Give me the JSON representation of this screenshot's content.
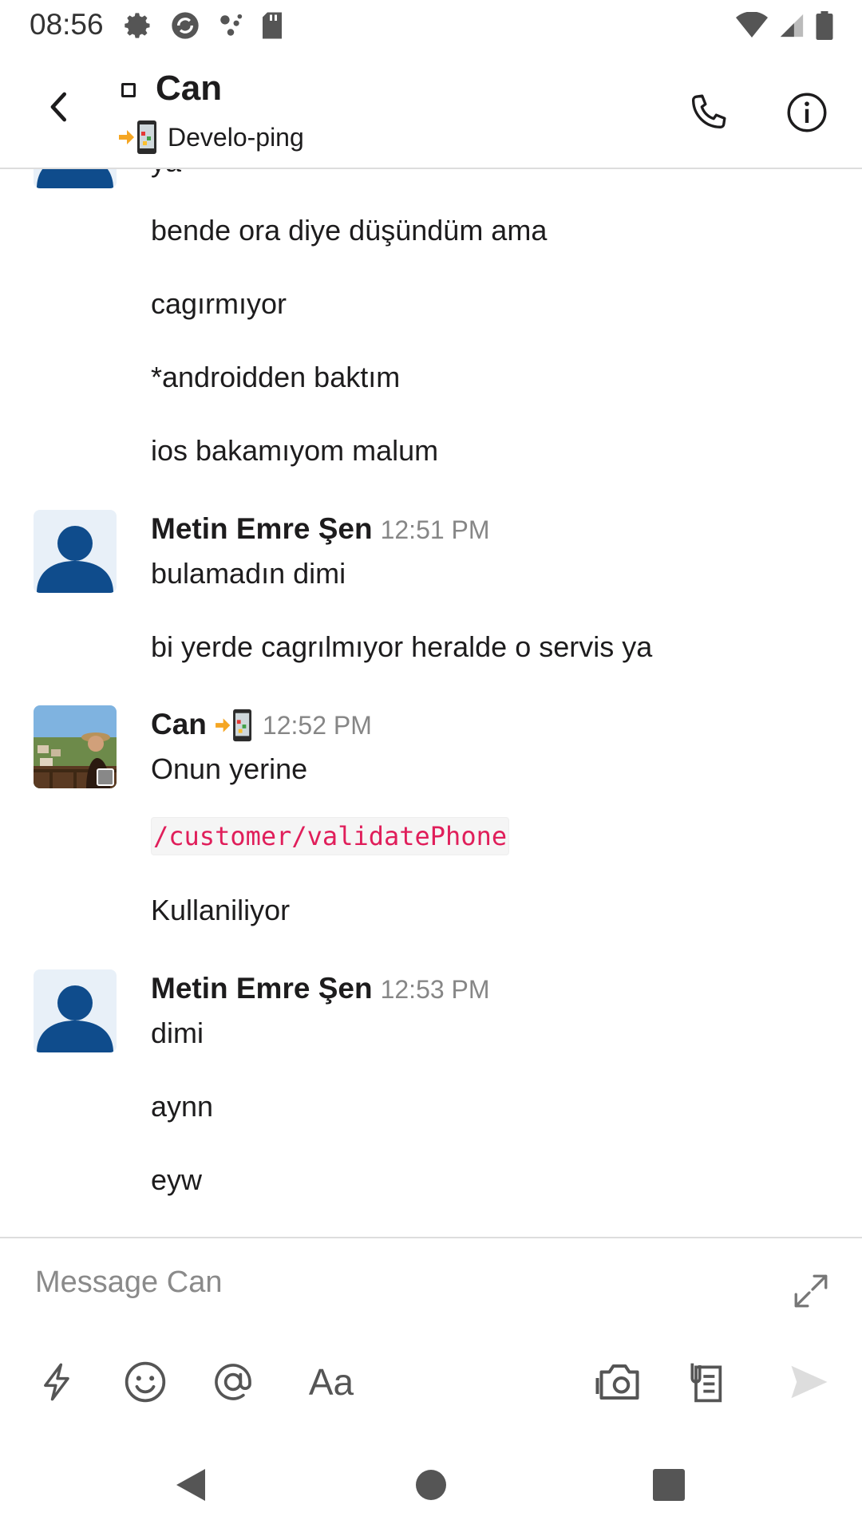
{
  "status_bar": {
    "time": "08:56",
    "left_icons": [
      "gear-icon",
      "sync-icon",
      "assistant-dots-icon",
      "sd-card-icon"
    ],
    "right_icons": [
      "wifi-icon",
      "signal-icon",
      "battery-icon"
    ]
  },
  "header": {
    "name": "Can",
    "status_text": "Develo-ping",
    "status_emoji": "arrow-phone-icon"
  },
  "messages": {
    "cut_off_text": "ya",
    "group0": {
      "lines": [
        "bende ora diye düşündüm ama",
        "cagırmıyor",
        "*androidden baktım",
        "ios bakamıyom malum"
      ]
    },
    "group1": {
      "author": "Metin Emre Şen",
      "time": "12:51 PM",
      "lines": [
        "bulamadın dimi",
        "bi yerde cagrılmıyor heralde o servis ya"
      ]
    },
    "group2": {
      "author": "Can",
      "time": "12:52 PM",
      "line1": "Onun yerine",
      "code": "/customer/validatePhone",
      "line2": "Kullaniliyor"
    },
    "group3": {
      "author": "Metin Emre Şen",
      "time": "12:53 PM",
      "lines": [
        "dimi",
        "aynn",
        "eyw"
      ]
    }
  },
  "composer": {
    "placeholder": "Message Can",
    "format_label": "Aa"
  },
  "colors": {
    "avatar_blue": "#0f4c8c",
    "code_red": "#e01e5a",
    "muted": "#868686"
  }
}
